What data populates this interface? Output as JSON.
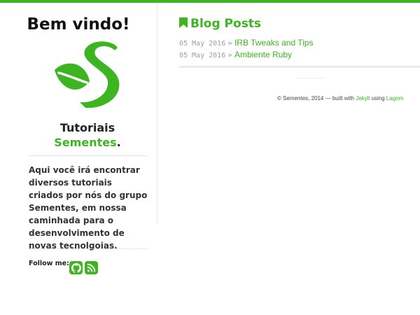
{
  "sidebar": {
    "welcome": "Bem vindo!",
    "brand_prefix": "Tutoriais",
    "brand_name": "Sementes",
    "brand_suffix": ".",
    "intro": "Aqui você irá encontrar diversos tutoriais criados por nós do grupo Sementes, em nossa caminhada para o desenvolvimento de novas tecnolgoias.",
    "follow_label": "Follow me:",
    "social_icons": [
      "github-icon",
      "rss-icon"
    ]
  },
  "main": {
    "title": "Blog Posts",
    "title_icon": "bookmark-icon",
    "separator": "»",
    "posts": [
      {
        "date": "05 May 2016",
        "title": "IRB Tweaks and Tips"
      },
      {
        "date": "05 May 2016",
        "title": "Ambiente Ruby"
      }
    ]
  },
  "footer": {
    "prefix": "© Sementes, 2014 — built with",
    "jekyll": "Jekyll",
    "middle": "using",
    "lagom": "Lagom"
  },
  "colors": {
    "accent": "#3cb521",
    "text": "#222222",
    "muted": "#9e9e9e"
  }
}
